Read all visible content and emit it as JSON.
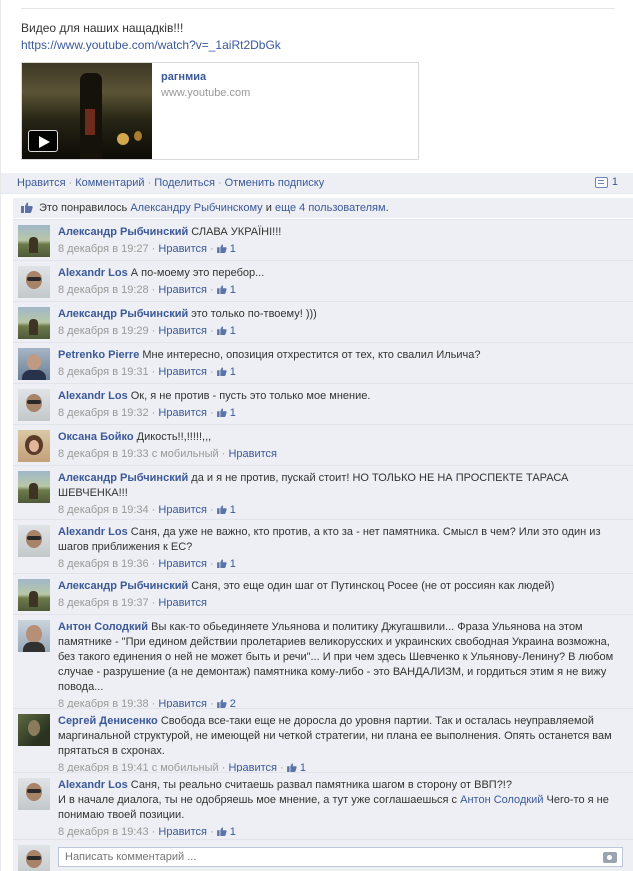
{
  "post": {
    "text": "Видео для наших нащадків!!!",
    "link": "https://www.youtube.com/watch?v=_1aiRt2DbGk"
  },
  "share": {
    "title": "pагнмиа",
    "domain": "www.youtube.com"
  },
  "actions": {
    "like": "Нравится",
    "comment": "Комментарий",
    "share": "Поделиться",
    "unsubscribe": "Отменить подписку",
    "comment_count": "1"
  },
  "likes": {
    "prefix": "Это понравилось",
    "person": "Александру Рыбчинскому",
    "middle": "и",
    "others": "еще 4 пользователям",
    "suffix": "."
  },
  "comments": [
    {
      "author": "Александр Рыбчинский",
      "text": "СЛАВА УКРАЇНІ!!!",
      "time": "8 декабря в 19:27",
      "mobile": "",
      "like": "Нравится",
      "likes": "1"
    },
    {
      "author": "Alexandr Los",
      "text": "А по-моему это перебор...",
      "time": "8 декабря в 19:28",
      "mobile": "",
      "like": "Нравится",
      "likes": "1"
    },
    {
      "author": "Александр Рыбчинский",
      "text": "это только по-твоему! )))",
      "time": "8 декабря в 19:29",
      "mobile": "",
      "like": "Нравится",
      "likes": "1"
    },
    {
      "author": "Petrenko Pierre",
      "text": "Мне интересно, опозиция отхрестится от тех, кто свалил Ильича?",
      "time": "8 декабря в 19:31",
      "mobile": "",
      "like": "Нравится",
      "likes": "1"
    },
    {
      "author": "Alexandr Los",
      "text": "Ок, я не против - пусть это только мое мнение.",
      "time": "8 декабря в 19:32",
      "mobile": "",
      "like": "Нравится",
      "likes": "1"
    },
    {
      "author": "Оксана Бойко",
      "text": "Дикость!!,!!!!!,,,",
      "time": "8 декабря в 19:33",
      "mobile": "с мобильный",
      "like": "Нравится",
      "likes": ""
    },
    {
      "author": "Александр Рыбчинский",
      "text": "да и я не против, пускай стоит! НО ТОЛЬКО НЕ НА ПРОСПЕКТЕ ТАРАСА ШЕВЧЕНКА!!!",
      "time": "8 декабря в 19:34",
      "mobile": "",
      "like": "Нравится",
      "likes": "1"
    },
    {
      "author": "Alexandr Los",
      "text": "Саня, да уже не важно, кто против, а кто за - нет памятника. Смысл в чем? Или это один из шагов приближения к ЕС?",
      "time": "8 декабря в 19:36",
      "mobile": "",
      "like": "Нравится",
      "likes": "1"
    },
    {
      "author": "Александр Рыбчинский",
      "text": "Саня, это еще один шаг от Путинскоц Росее (не от россиян как людей)",
      "time": "8 декабря в 19:37",
      "mobile": "",
      "like": "Нравится",
      "likes": ""
    },
    {
      "author": "Антон Солодкий",
      "text": "Вы как-то обьединяете Ульянова и политику Джугашвили... Фраза Ульянова на этом памятнике - \"При едином действии пролетариев великорусских и украинских свободная Украина возможна, без такого единения о ней не может быть и речи\"... И при чем здесь Шевченко к Ульянову-Ленину? В любом случае - разрушение (а не демонтаж) памятника кому-либо - это ВАНДАЛИЗМ, и гордиться этим я не вижу повода...",
      "time": "8 декабря в 19:38",
      "mobile": "",
      "like": "Нравится",
      "likes": "2"
    },
    {
      "author": "Сергей Денисенко",
      "text": "Свобода все-таки еще не доросла до уровня партии. Так и осталась неуправляемой маргинальной структурой, не имеющей ни четкой стратегии, ни плана ее выполнения. Опять останется вам прятаться в схронах.",
      "time": "8 декабря в 19:41",
      "mobile": "с мобильный",
      "like": "Нравится",
      "likes": "1"
    },
    {
      "author": "Alexandr Los",
      "text": "Саня, ты реально считаешь развал памятника шагом в сторону от ВВП?!?",
      "text2": "И в начале диалога, ты не одобряешь мое мнение, а тут уже соглашаешься с",
      "mention": "Антон Солодкий",
      "text3": "Чего-то я не понимаю твоей позиции.",
      "time": "8 декабря в 19:43",
      "mobile": "",
      "like": "Нравится",
      "likes": "1"
    }
  ],
  "composer": {
    "placeholder": "Написать комментарий ..."
  }
}
